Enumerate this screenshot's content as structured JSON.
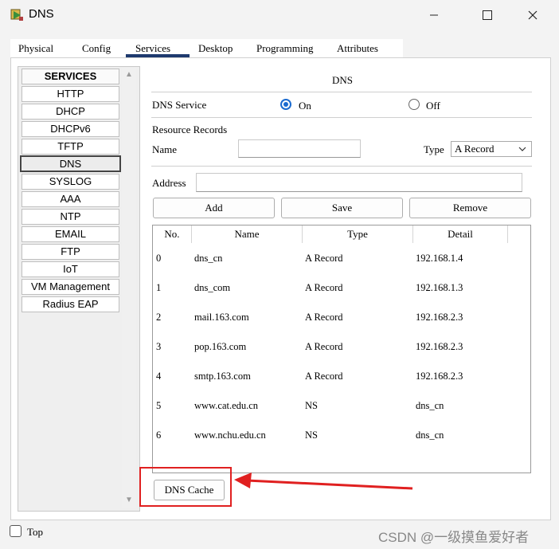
{
  "window": {
    "title": "DNS",
    "controls": [
      "minimize",
      "maximize",
      "close"
    ]
  },
  "tabs": [
    "Physical",
    "Config",
    "Services",
    "Desktop",
    "Programming",
    "Attributes"
  ],
  "active_tab": "Services",
  "sidebar": {
    "header": "SERVICES",
    "items": [
      "HTTP",
      "DHCP",
      "DHCPv6",
      "TFTP",
      "DNS",
      "SYSLOG",
      "AAA",
      "NTP",
      "EMAIL",
      "FTP",
      "IoT",
      "VM Management",
      "Radius EAP"
    ],
    "selected": "DNS"
  },
  "dns": {
    "header": "DNS",
    "service_label": "DNS Service",
    "on_label": "On",
    "off_label": "Off",
    "service_state": "On",
    "resource_records_label": "Resource Records",
    "name_label": "Name",
    "name_value": "",
    "type_label": "Type",
    "type_value": "A Record",
    "address_label": "Address",
    "address_value": "",
    "buttons": {
      "add": "Add",
      "save": "Save",
      "remove": "Remove"
    },
    "table": {
      "columns": [
        "No.",
        "Name",
        "Type",
        "Detail"
      ],
      "rows": [
        [
          "0",
          "dns_cn",
          "A Record",
          "192.168.1.4"
        ],
        [
          "1",
          "dns_com",
          "A Record",
          "192.168.1.3"
        ],
        [
          "2",
          "mail.163.com",
          "A Record",
          "192.168.2.3"
        ],
        [
          "3",
          "pop.163.com",
          "A Record",
          "192.168.2.3"
        ],
        [
          "4",
          "smtp.163.com",
          "A Record",
          "192.168.2.3"
        ],
        [
          "5",
          "www.cat.edu.cn",
          "NS",
          "dns_cn"
        ],
        [
          "6",
          "www.nchu.edu.cn",
          "NS",
          "dns_cn"
        ]
      ]
    },
    "dns_cache_button": "DNS Cache"
  },
  "footer": {
    "top_label": "Top",
    "top_checked": false
  },
  "watermark": "CSDN @一级摸鱼爱好者",
  "colors": {
    "accent": "#1a6ad0",
    "annotation_red": "#e02020",
    "tab_underline": "#1e3a6e"
  }
}
